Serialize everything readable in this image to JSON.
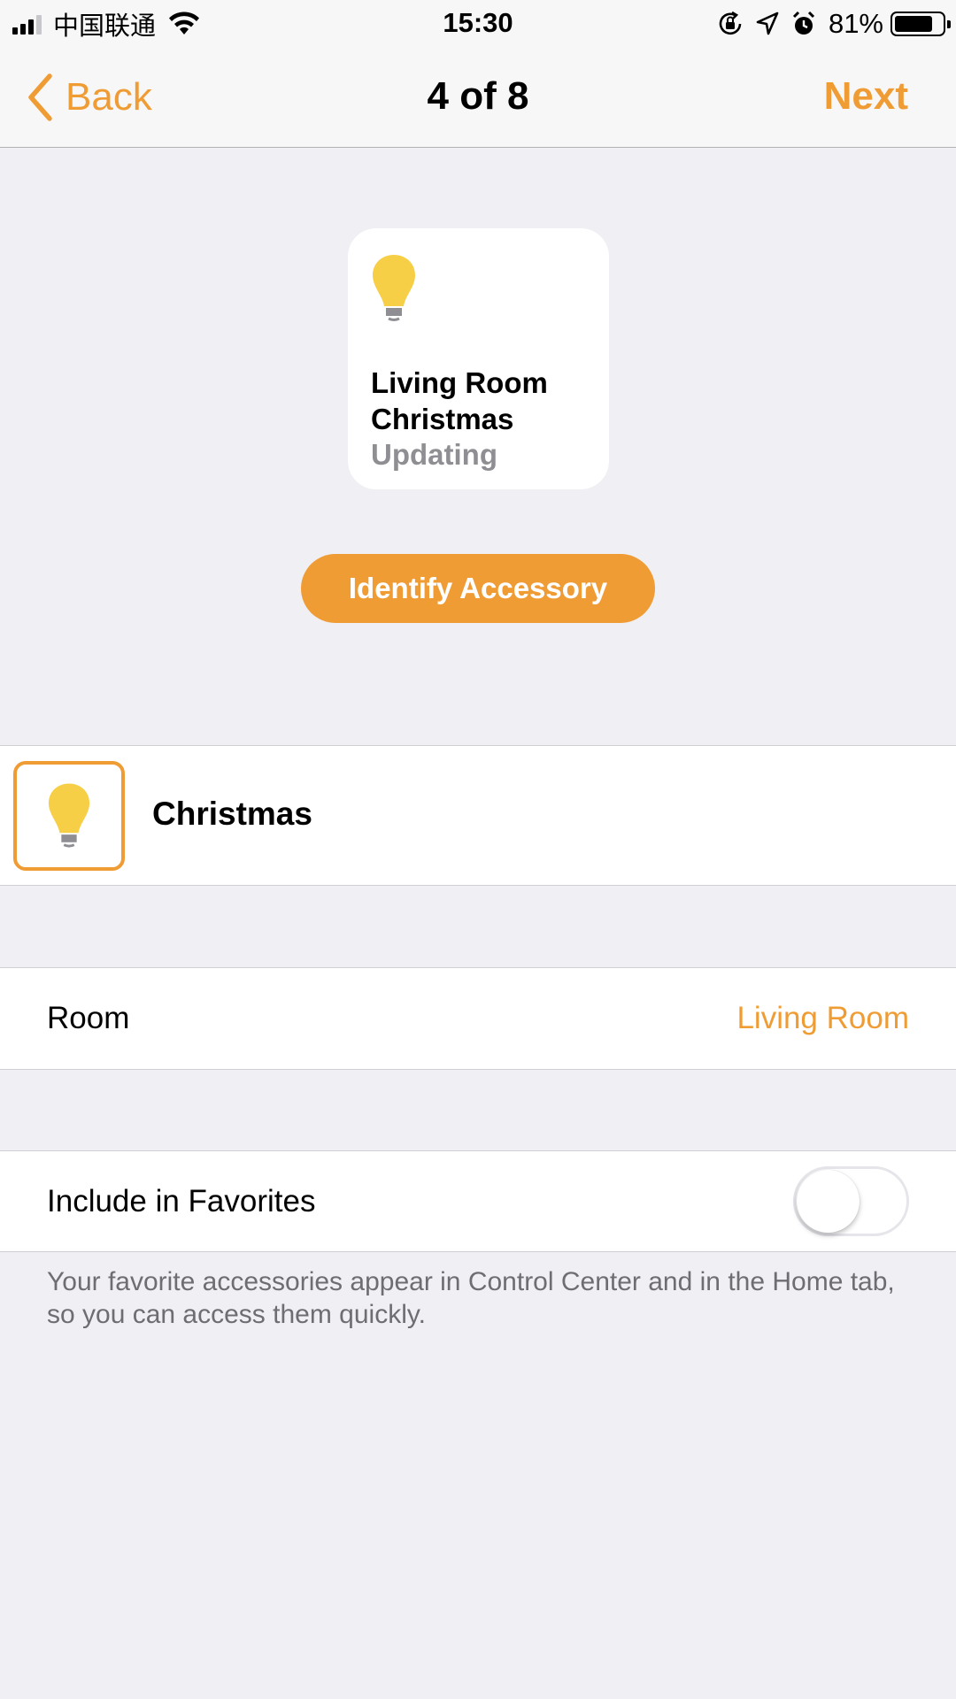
{
  "status_bar": {
    "carrier": "中国联通",
    "time": "15:30",
    "battery_percent": "81%",
    "battery_level": 0.81
  },
  "nav": {
    "back_label": "Back",
    "title": "4 of 8",
    "next_label": "Next"
  },
  "tile": {
    "name": "Living Room Christmas",
    "status": "Updating",
    "icon": "lightbulb-icon"
  },
  "identify_button": {
    "label": "Identify Accessory"
  },
  "accessory": {
    "name": "Christmas",
    "icon": "lightbulb-icon"
  },
  "room_row": {
    "label": "Room",
    "value": "Living Room"
  },
  "favorites_row": {
    "label": "Include in Favorites",
    "enabled": false,
    "note": "Your favorite accessories appear in Control Center and in the Home tab, so you can access them quickly."
  },
  "colors": {
    "accent": "#f09c35",
    "bulb": "#f7cf46",
    "background": "#efeff4",
    "secondary_text": "#8e8e93"
  }
}
